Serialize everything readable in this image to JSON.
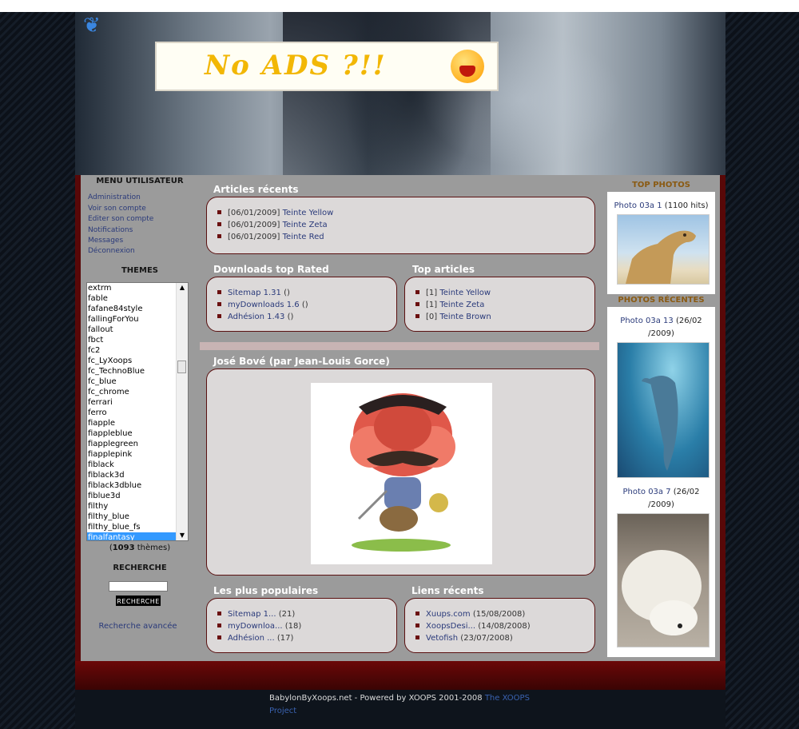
{
  "user_menu": {
    "title": "MENU UTILISATEUR",
    "items": [
      "Administration",
      "Voir son compte",
      "Editer son compte",
      "Notifications",
      "Messages",
      "Déconnexion"
    ]
  },
  "themes": {
    "title": "THEMES",
    "options": [
      "extrm",
      "fable",
      "fafane84style",
      "fallingForYou",
      "fallout",
      "fbct",
      "fc2",
      "fc_LyXoops",
      "fc_TechnoBlue",
      "fc_blue",
      "fc_chrome",
      "ferrari",
      "ferro",
      "fiapple",
      "fiappleblue",
      "fiapplegreen",
      "fiapplepink",
      "fiblack",
      "fiblack3d",
      "fiblack3dblue",
      "fiblue3d",
      "filthy",
      "filthy_blue",
      "filthy_blue_fs",
      "finalfantasy"
    ],
    "selected": "finalfantasy",
    "count": "1093",
    "count_suffix": "thèmes"
  },
  "search": {
    "title": "RECHERCHE",
    "button_label": "Recherche",
    "advanced_link": "Recherche avancée"
  },
  "recent_articles": {
    "title": "Articles récents",
    "items": [
      {
        "date": "[06/01/2009]",
        "title": "Teinte Yellow"
      },
      {
        "date": "[06/01/2009]",
        "title": "Teinte Zeta"
      },
      {
        "date": "[06/01/2009]",
        "title": "Teinte Red"
      }
    ]
  },
  "downloads_top": {
    "title": "Downloads top Rated",
    "items": [
      {
        "name": "Sitemap 1.31",
        "rating": "()"
      },
      {
        "name": "myDownloads 1.6",
        "rating": "()"
      },
      {
        "name": "Adhésion 1.43",
        "rating": "()"
      }
    ]
  },
  "top_articles": {
    "title": "Top articles",
    "items": [
      {
        "count": "[1]",
        "title": "Teinte Yellow"
      },
      {
        "count": "[1]",
        "title": "Teinte Zeta"
      },
      {
        "count": "[0]",
        "title": "Teinte Brown"
      }
    ]
  },
  "featured": {
    "title": "José Bové (par Jean-Louis Gorce)"
  },
  "popular": {
    "title": "Les plus populaires",
    "items": [
      {
        "name": "Sitemap 1...",
        "count": "(21)"
      },
      {
        "name": "myDownloa...",
        "count": "(18)"
      },
      {
        "name": "Adhésion ...",
        "count": "(17)"
      }
    ]
  },
  "recent_links": {
    "title": "Liens récents",
    "items": [
      {
        "name": "Xuups.com",
        "date": "(15/08/2008)"
      },
      {
        "name": "XoopsDesi...",
        "date": "(14/08/2008)"
      },
      {
        "name": "Vetofish",
        "date": "(23/07/2008)"
      }
    ]
  },
  "top_photos": {
    "title": "TOP PHOTOS",
    "caption_link": "Photo 03a 1",
    "caption_rest": "(1100 hits)"
  },
  "recent_photos": {
    "title": "PHOTOS RÉCENTES",
    "photos": [
      {
        "link": "Photo 03a 13",
        "line1_rest": "(26/02",
        "line2": "/2009)"
      },
      {
        "link": "Photo 03a 7",
        "line1_rest": "(26/02",
        "line2": "/2009)"
      }
    ]
  },
  "banner": {
    "text": "No ADS ?!!"
  },
  "footer": {
    "text": "BabylonByXoops.net - Powered by XOOPS 2001-2008",
    "link": "The XOOPS Project"
  },
  "colors": {
    "accent": "#5a1010",
    "link": "#2a3a7a",
    "panel": "#9b9b9b"
  }
}
